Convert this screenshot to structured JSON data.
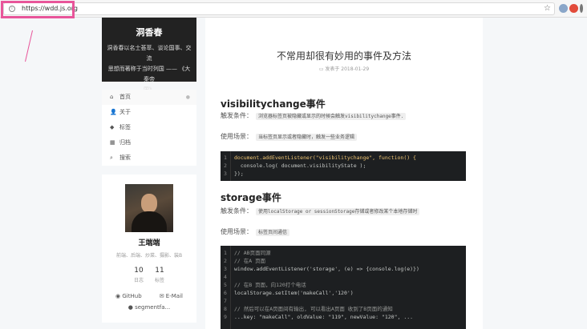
{
  "browser": {
    "url": "https://wdd.js.org"
  },
  "site": {
    "title": "洞香春",
    "subtitle_lines": [
      "洞香春以名士荟萃、谈论国事、交流",
      "思想而著称于当时列国 —— 《大秦帝",
      "国》"
    ]
  },
  "menu": {
    "items": [
      {
        "icon": "home-icon",
        "label": "首页"
      },
      {
        "icon": "user-icon",
        "label": "关于"
      },
      {
        "icon": "tags-icon",
        "label": "标签"
      },
      {
        "icon": "archive-icon",
        "label": "归档"
      },
      {
        "icon": "search-icon",
        "label": "搜索"
      }
    ]
  },
  "profile": {
    "name": "王端端",
    "description": "前端、后端、炒菜、摄影、装B",
    "posts_count": "10",
    "posts_label": "日志",
    "tags_count": "11",
    "tags_label": "标签",
    "link_github": "GitHub",
    "link_email": "E-Mail",
    "link_segmentfault": "segmentfa..."
  },
  "post": {
    "title": "不常用却很有妙用的事件及方法",
    "meta": "发表于 2018-01-29",
    "section1_title": "visibilitychange事件",
    "trigger_label": "触发条件：",
    "trigger1_text": "浏览器标签页被隐藏或显示的时候会触发visibilitychange事件.",
    "usage_label": "使用场景：",
    "usage1_text": "当标签页显示或者隐藏时，触发一些业务逻辑",
    "section2_title": "storage事件",
    "trigger2_text": "使用localStorage or sessionStorage存储或者修改某个本地存储时",
    "usage2_text": "标签页间通信"
  },
  "code1": {
    "line_numbers": [
      "1",
      "2",
      "3"
    ],
    "lines": [
      "document.addEventListener(\"visibilitychange\", function() {",
      "  console.log( document.visibilityState );",
      "});"
    ]
  },
  "code2": {
    "line_numbers": [
      "1",
      "2",
      "3",
      "4",
      "5",
      "6",
      "7",
      "8",
      "9"
    ],
    "lines": [
      "// AB页面同源",
      "// 在A 页面",
      "window.addEventListener('storage', (e) => {console.log(e)})",
      "",
      "// 在B 页面，向120打个电话",
      "localStorage.setItem('makeCall','120')",
      "",
      "// 然后可以在A页面间有输出, 可以看出A页面 收到了B页面的通知",
      "...key: \"makeCall\", oldValue: \"119\", newValue: \"120\", ..."
    ]
  },
  "colors": {
    "annotation": "#e8559a",
    "code_bg": "#1d1f21",
    "brand_bg": "#222222"
  }
}
